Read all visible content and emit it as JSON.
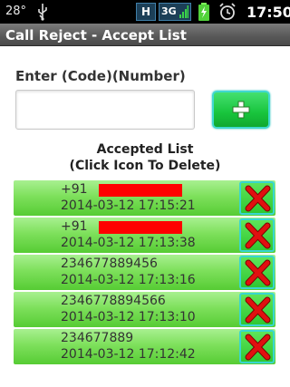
{
  "status_bar": {
    "temperature": "28°",
    "network_h": "H",
    "network_3g": "3G",
    "time": "17:50"
  },
  "title_bar": {
    "title": "Call Reject - Accept List"
  },
  "form": {
    "label": "Enter (Code)(Number)",
    "input_value": "",
    "add_button_icon": "plus-icon"
  },
  "list": {
    "heading_line1": "Accepted List",
    "heading_line2": "(Click Icon To Delete)",
    "items": [
      {
        "number": "+91",
        "timestamp": "2014-03-12 17:15:21",
        "redacted": true
      },
      {
        "number": "+91",
        "timestamp": "2014-03-12 17:13:38",
        "redacted": true
      },
      {
        "number": "234677889456",
        "timestamp": "2014-03-12 17:13:16",
        "redacted": false
      },
      {
        "number": "2346778894566",
        "timestamp": "2014-03-12 17:13:10",
        "redacted": false
      },
      {
        "number": "234677889",
        "timestamp": "2014-03-12 17:12:42",
        "redacted": false
      }
    ],
    "delete_icon": "delete-x-icon"
  },
  "colors": {
    "row_green": "#7ee05c",
    "button_border": "#38d6d0",
    "delete_red": "#e01010",
    "redaction": "#ff0000"
  }
}
